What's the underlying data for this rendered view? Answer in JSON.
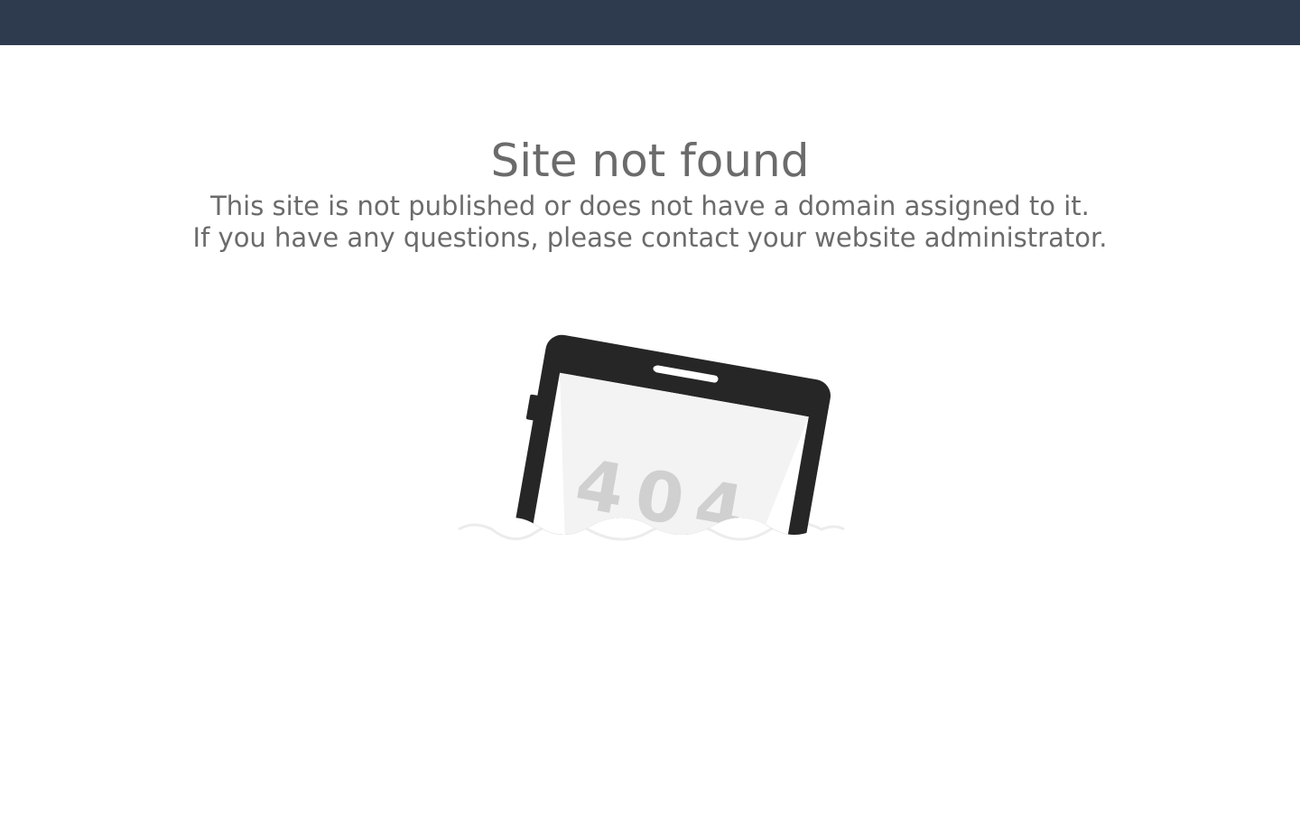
{
  "page": {
    "title": "Site not found",
    "message_line_1": "This site is not published or does not have a domain assigned to it.",
    "message_line_2": "If you have any questions, please contact your website administrator."
  },
  "illustration": {
    "icon": "tablet-404-illustration",
    "screen_text": "404"
  },
  "colors": {
    "top_bar": "#2e3b4e",
    "text": "#6b6b6b",
    "device": "#262626",
    "screen": "#ffffff",
    "digits": "#d0d0d0"
  }
}
